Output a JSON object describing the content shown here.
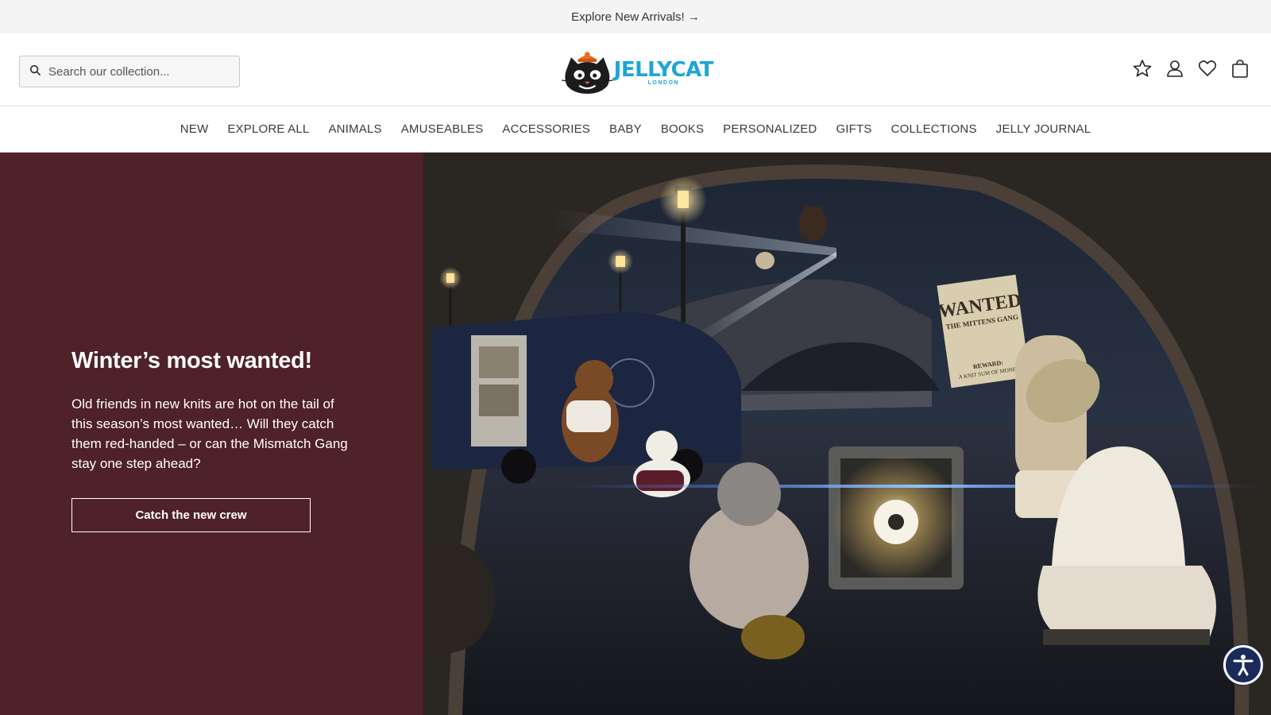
{
  "announcement": {
    "text": "Explore New Arrivals! →"
  },
  "search": {
    "placeholder": "Search our collection..."
  },
  "logo": {
    "word": "JELLYCAT",
    "sub": "LONDON"
  },
  "header_icons": [
    "star-icon",
    "account-icon",
    "heart-icon",
    "bag-icon"
  ],
  "nav": {
    "items": [
      "NEW",
      "EXPLORE ALL",
      "ANIMALS",
      "AMUSEABLES",
      "ACCESSORIES",
      "BABY",
      "BOOKS",
      "PERSONALIZED",
      "GIFTS",
      "COLLECTIONS",
      "JELLY JOURNAL"
    ]
  },
  "hero": {
    "title": "Winter’s most wanted!",
    "body": "Old friends in new knits are hot on the tail of this season’s most wanted… Will they catch them red-handed – or can the Mismatch Gang stay one step ahead?",
    "cta": "Catch the new crew",
    "poster_title": "WANTED",
    "poster_sub": "THE MITTENS GANG",
    "poster_reward": "REWARD:",
    "poster_reward_sub": "A KNIT SUM OF MONEY"
  },
  "colors": {
    "hero_bg": "#4f2128",
    "brand": "#1ea6d6",
    "accessibility": "#1a2a5a"
  }
}
